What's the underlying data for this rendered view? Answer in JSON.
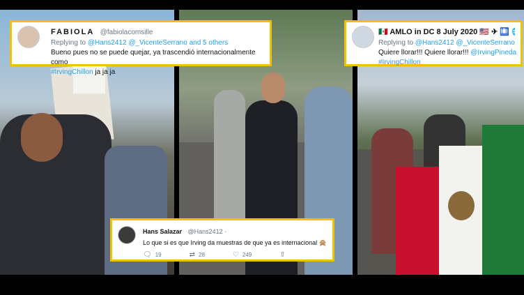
{
  "tweets": {
    "fabiola": {
      "name": "FABIOLA",
      "handle": "@fabiolacomsille",
      "replying_prefix": "Replying to",
      "replying_to": "@Hans2412 @_VicenteSerrano and 5 others",
      "text": "Bueno pues no se puede quejar, ya trascendió internacionalmente como",
      "hashtag": "#IrvingChillon",
      "text_end": "ja ja ja"
    },
    "amlo": {
      "name": "🇲🇽 AMLO in DC 8 July 2020 🇺🇸 ✈ 🛄 🌐",
      "replying_prefix": "Replying to",
      "replying_to": "@Hans2412 @_VicenteSerrano an",
      "text": "Quiere llorar!!! Quiere llorar!!!",
      "mention": "@IrvingPineda",
      "hashtag": "#IrvingChillon"
    },
    "hans": {
      "name": "Hans Salazar",
      "handle": "@Hans2412 ·",
      "text": "Lo que si es que Irving da muestras de que ya es internacional 🙊",
      "replies": "19",
      "retweets": "28",
      "likes": "249"
    }
  },
  "icons": [
    "reply-icon",
    "retweet-icon",
    "like-icon",
    "share-icon"
  ],
  "colors": {
    "highlight_border": "#f2c200",
    "link": "#1da1f2",
    "muted": "#657786"
  }
}
